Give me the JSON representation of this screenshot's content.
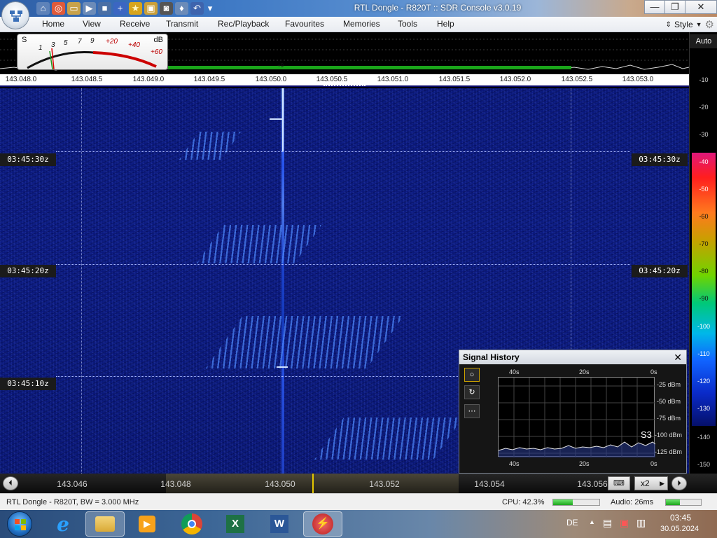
{
  "window": {
    "title": "RTL Dongle - R820T :: SDR Console v3.0.19"
  },
  "menu": {
    "items": [
      "Home",
      "View",
      "Receive",
      "Transmit",
      "Rec/Playback",
      "Favourites",
      "Memories",
      "Tools",
      "Help"
    ],
    "style_label": "Style"
  },
  "smeter": {
    "s_label": "S",
    "db_label": "dB",
    "s_marks": [
      "1",
      "3",
      "5",
      "7",
      "9"
    ],
    "db_marks": [
      "+20",
      "+40",
      "+60"
    ],
    "marker": "+9"
  },
  "frequency_scale": [
    "143.048.0",
    "143.048.5",
    "143.049.0",
    "143.049.5",
    "143.050.0",
    "143.050.5",
    "143.051.0",
    "143.051.5",
    "143.052.0",
    "143.052.5",
    "143.053.0"
  ],
  "waterfall": {
    "timestamps": [
      "03:45:30z",
      "03:45:20z",
      "03:45:10z"
    ]
  },
  "db_scale": {
    "auto_label": "Auto",
    "labels": [
      "-10",
      "-20",
      "-30",
      "-40",
      "-50",
      "-60",
      "-70",
      "-80",
      "-90",
      "-100",
      "-110",
      "-120",
      "-130",
      "-140",
      "-150"
    ]
  },
  "signal_history": {
    "title": "Signal History",
    "close": "✕",
    "time_labels_top": [
      "40s",
      "20s",
      "0s"
    ],
    "time_labels_bottom": [
      "40s",
      "20s",
      "0s"
    ],
    "dbm_labels": [
      "-25 dBm",
      "-50 dBm",
      "-75 dBm",
      "-100 dBm",
      "-125 dBm"
    ],
    "s_reading": "S3",
    "tool_labels": [
      "○",
      "↻",
      "⋯"
    ]
  },
  "tuner": {
    "frequencies": [
      "143.046",
      "143.048",
      "143.050",
      "143.052",
      "143.054",
      "143.056"
    ],
    "zoom": "x2"
  },
  "status": {
    "device": "RTL Dongle - R820T, BW = 3.000 MHz",
    "cpu": "CPU: 42.3%",
    "cpu_level": 0.423,
    "audio": "Audio: 26ms",
    "audio_level": 0.4
  },
  "taskbar": {
    "language": "DE",
    "time": "03:45",
    "date": "30.05.2024"
  }
}
